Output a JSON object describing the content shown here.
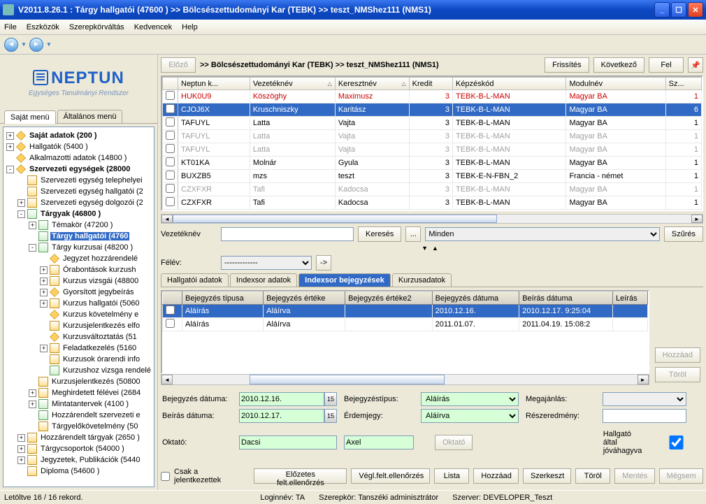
{
  "window": {
    "title": "V2011.8.26.1 : Tárgy hallgatói (47600  )   >> Bölcsészettudományi Kar (TEBK) >> teszt_NMShez111 (NMS1)"
  },
  "menubar": [
    "File",
    "Eszközök",
    "Szerepkörváltás",
    "Kedvencek",
    "Help"
  ],
  "logo": {
    "big": "NEPTUN",
    "sub": "Egységes Tanulmányi Rendszer"
  },
  "lefttabs": {
    "a": "Saját menü",
    "b": "Általános menü"
  },
  "tree": [
    {
      "ind": 1,
      "exp": "+",
      "ic": "dia",
      "bold": true,
      "label": "Saját adatok (200  )"
    },
    {
      "ind": 1,
      "exp": "+",
      "ic": "dia",
      "label": "Hallgatók (5400  )"
    },
    {
      "ind": 1,
      "exp": "",
      "ic": "dia",
      "label": "Alkalmazotti adatok (14800  )"
    },
    {
      "ind": 1,
      "exp": "-",
      "ic": "dia",
      "bold": true,
      "label": "Szervezeti egységek (28000"
    },
    {
      "ind": 2,
      "exp": "",
      "ic": "card",
      "label": "Szervezeti egység telephelyei"
    },
    {
      "ind": 2,
      "exp": "",
      "ic": "card",
      "label": "Szervezeti egység hallgatói (2"
    },
    {
      "ind": 2,
      "exp": "+",
      "ic": "card",
      "label": "Szervezeti egység dolgozói (2"
    },
    {
      "ind": 2,
      "exp": "-",
      "ic": "fold",
      "bold": true,
      "label": "Tárgyak (46800  )"
    },
    {
      "ind": 3,
      "exp": "+",
      "ic": "fold",
      "label": "Témakör (47200  )"
    },
    {
      "ind": 3,
      "exp": "",
      "ic": "fold",
      "bold": true,
      "sel": true,
      "label": "Tárgy hallgatói (4760"
    },
    {
      "ind": 3,
      "exp": "-",
      "ic": "fold",
      "label": "Tárgy kurzusai (48200  )"
    },
    {
      "ind": 4,
      "exp": "",
      "ic": "dia",
      "label": "Jegyzet hozzárendelé"
    },
    {
      "ind": 4,
      "exp": "+",
      "ic": "card",
      "label": "Órabontások kurzush"
    },
    {
      "ind": 4,
      "exp": "+",
      "ic": "card",
      "label": "Kurzus vizsgái (48800"
    },
    {
      "ind": 4,
      "exp": "+",
      "ic": "dia",
      "label": "Gyorsított jegybeírás"
    },
    {
      "ind": 4,
      "exp": "+",
      "ic": "card",
      "label": "Kurzus hallgatói (5060"
    },
    {
      "ind": 4,
      "exp": "",
      "ic": "dia",
      "label": "Kurzus követelmény e"
    },
    {
      "ind": 4,
      "exp": "",
      "ic": "card",
      "label": "Kurzusjelentkezés elfo"
    },
    {
      "ind": 4,
      "exp": "",
      "ic": "dia",
      "label": "Kurzusváltoztatás (51"
    },
    {
      "ind": 4,
      "exp": "+",
      "ic": "card",
      "label": "Feladatkezelés (5160"
    },
    {
      "ind": 4,
      "exp": "",
      "ic": "card",
      "label": "Kurzusok órarendi info"
    },
    {
      "ind": 4,
      "exp": "",
      "ic": "fold",
      "label": "Kurzushoz vizsga rendelé"
    },
    {
      "ind": 3,
      "exp": "",
      "ic": "card",
      "label": "Kurzusjelentkezés (50800"
    },
    {
      "ind": 3,
      "exp": "+",
      "ic": "card",
      "label": "Meghirdetett félévei (2684"
    },
    {
      "ind": 3,
      "exp": "+",
      "ic": "fold",
      "label": "Mintatantervek (4100  )"
    },
    {
      "ind": 3,
      "exp": "",
      "ic": "fold",
      "label": "Hozzárendelt szervezeti e"
    },
    {
      "ind": 3,
      "exp": "",
      "ic": "card",
      "label": "Tárgyelőkövetelmény (50"
    },
    {
      "ind": 2,
      "exp": "+",
      "ic": "card",
      "label": "Hozzárendelt tárgyak (2650  )"
    },
    {
      "ind": 2,
      "exp": "+",
      "ic": "card",
      "label": "Tárgycsoportok (54000  )"
    },
    {
      "ind": 2,
      "exp": "+",
      "ic": "card",
      "label": "Jegyzetek, Publikációk (5440"
    },
    {
      "ind": 2,
      "exp": "",
      "ic": "card",
      "label": "Diploma (54600  )"
    }
  ],
  "toprow": {
    "prev": "Előző",
    "bc": ">>  Bölcsészettudományi Kar (TEBK) >> teszt_NMShez111 (NMS1)",
    "refresh": "Frissítés",
    "next": "Következő",
    "up": "Fel"
  },
  "grid": {
    "headers": [
      "",
      "Neptun k...",
      "Vezetéknév",
      "Keresztnév",
      "Kredit",
      "Képzéskód",
      "Modulnév",
      "Sz..."
    ],
    "rows": [
      {
        "cls": "red",
        "c": [
          "HUK0U9",
          "Köszöghy",
          "Maximusz",
          "3",
          "TEBK-B-L-MAN",
          "Magyar BA",
          "1"
        ]
      },
      {
        "cls": "sel",
        "c": [
          "CJOJ6X",
          "Kruschniszky",
          "Karitász",
          "3",
          "TEBK-B-L-MAN",
          "Magyar BA",
          "6"
        ]
      },
      {
        "cls": "",
        "c": [
          "TAFUYL",
          "Latta",
          "Vajta",
          "3",
          "TEBK-B-L-MAN",
          "Magyar BA",
          "1"
        ]
      },
      {
        "cls": "dis",
        "c": [
          "TAFUYL",
          "Latta",
          "Vajta",
          "3",
          "TEBK-B-L-MAN",
          "Magyar BA",
          "1"
        ]
      },
      {
        "cls": "dis",
        "c": [
          "TAFUYL",
          "Latta",
          "Vajta",
          "3",
          "TEBK-B-L-MAN",
          "Magyar BA",
          "1"
        ]
      },
      {
        "cls": "",
        "c": [
          "KT01KA",
          "Molnár",
          "Gyula",
          "3",
          "TEBK-B-L-MAN",
          "Magyar BA",
          "1"
        ]
      },
      {
        "cls": "",
        "c": [
          "BUXZB5",
          "mzs",
          "teszt",
          "3",
          "TEBK-E-N-FBN_2",
          "Francia - német",
          "1"
        ]
      },
      {
        "cls": "dis",
        "c": [
          "CZXFXR",
          "Tafi",
          "Kadocsa",
          "3",
          "TEBK-B-L-MAN",
          "Magyar BA",
          "1"
        ]
      },
      {
        "cls": "",
        "c": [
          "CZXFXR",
          "Tafi",
          "Kadocsa",
          "3",
          "TEBK-B-L-MAN",
          "Magyar BA",
          "1"
        ]
      }
    ]
  },
  "search": {
    "label": "Vezetéknév",
    "btn": "Keresés",
    "dots": "...",
    "all": "Minden",
    "filter": "Szűrés"
  },
  "felev": {
    "label": "Félév:",
    "value": "-------------"
  },
  "btabs": [
    "Hallgatói adatok",
    "Indexsor adatok",
    "Indexsor bejegyzések",
    "Kurzusadatok"
  ],
  "subgrid": {
    "headers": [
      "",
      "Bejegyzés típusa",
      "Bejegyzés értéke",
      "Bejegyzés értéke2",
      "Bejegyzés dátuma",
      "Beírás dátuma",
      "Leírás"
    ],
    "rows": [
      {
        "cls": "sel",
        "c": [
          "Aláírás",
          "Aláírva",
          "",
          "2010.12.16.",
          "2010.12.17. 9:25:04",
          ""
        ]
      },
      {
        "cls": "",
        "c": [
          "Aláírás",
          "Aláírva",
          "",
          "2011.01.07.",
          "2011.04.19. 15:08:2",
          ""
        ]
      }
    ]
  },
  "sidebtns": {
    "add": "Hozzáad",
    "del": "Töröl"
  },
  "form": {
    "bejdat_l": "Bejegyzés dátuma:",
    "bejdat": "2010.12.16.",
    "bejtip_l": "Bejegyzéstípus:",
    "bejtip": "Aláírás",
    "megaj_l": "Megajánlás:",
    "beidat_l": "Beírás dátuma:",
    "beidat": "2010.12.17.",
    "erdem_l": "Érdemjegy:",
    "erdem": "Aláírva",
    "resz_l": "Részeredmény:",
    "okt_l": "Oktató:",
    "okt1": "Dacsi",
    "okt2": "Axel",
    "oktbtn": "Oktató",
    "hallg": "Hallgató által jóváhagyva"
  },
  "btnrow": {
    "csak": "Csak a jelentkezettek",
    "elo": "Előzetes felt.ellenőrzés",
    "veg": "Végl.felt.ellenőrzés",
    "lista": "Lista",
    "hozzaad": "Hozzáad",
    "szerk": "Szerkeszt",
    "torol": "Töröl",
    "mentes": "Mentés",
    "megsem": "Mégsem"
  },
  "status": {
    "left": "Letöltve 16 / 16 rekord.",
    "login": "Loginnév: TA",
    "role": "Szerepkör: Tanszéki adminisztrátor",
    "server": "Szerver: DEVELOPER_Teszt"
  }
}
